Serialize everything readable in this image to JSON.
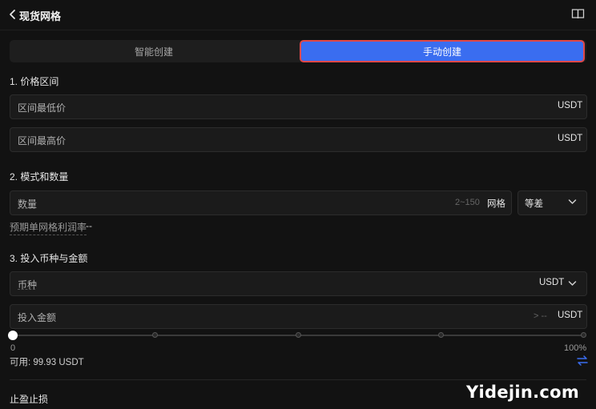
{
  "header": {
    "title": "现货网格",
    "back_icon": "chevron-left-icon",
    "guide_icon": "book-icon"
  },
  "mode_tabs": {
    "smart": "智能创建",
    "manual": "手动创建",
    "active": "manual",
    "active_color": "#3a6df0"
  },
  "price_range": {
    "section_title": "1. 价格区间",
    "min_label": "区间最低价",
    "min_unit": "USDT",
    "max_label": "区间最高价",
    "max_unit": "USDT"
  },
  "mode_quantity": {
    "section_title": "2. 模式和数量",
    "quantity_label": "数量",
    "quantity_hint": "2~150",
    "quantity_unit": "网格",
    "mode_select": "等差",
    "profit_label": "预期单网格利润率",
    "profit_value": "--"
  },
  "investment": {
    "section_title": "3. 投入币种与金额",
    "coin_label": "币种",
    "coin_value": "USDT",
    "amount_label": "投入金额",
    "amount_hint": "> --",
    "amount_unit": "USDT",
    "slider_min": "0",
    "slider_max": "100%",
    "slider_value": 0,
    "available": "可用: 99.93 USDT"
  },
  "stop": {
    "section_title": "止盈止损"
  },
  "watermark": "Yidejin.com"
}
